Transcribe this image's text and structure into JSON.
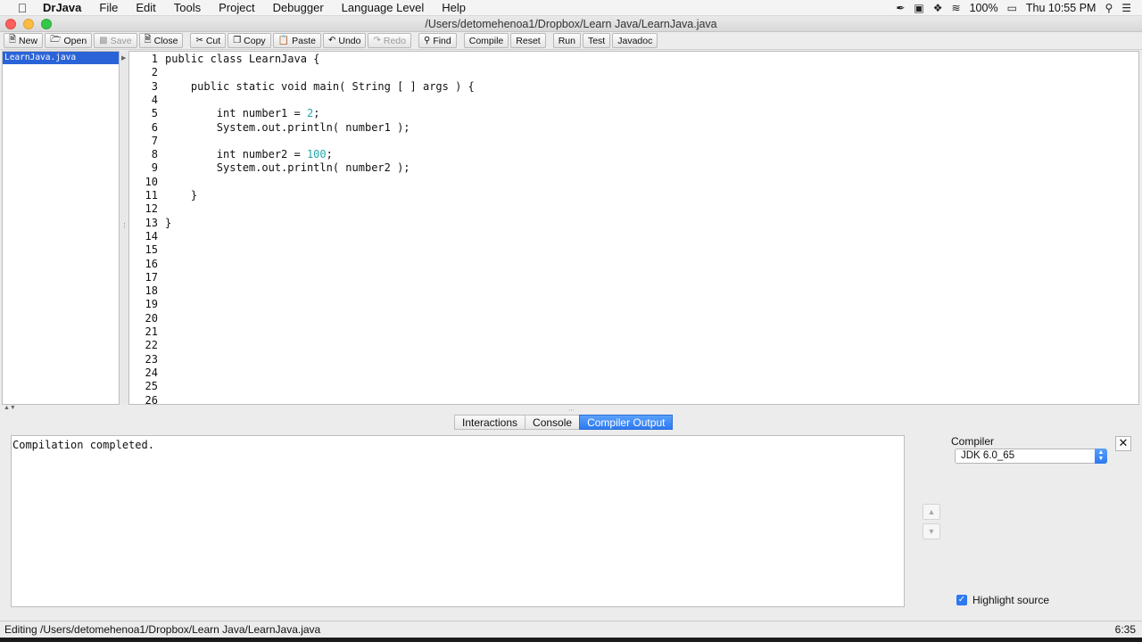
{
  "menubar": {
    "app_name": "DrJava",
    "items": [
      "File",
      "Edit",
      "Tools",
      "Project",
      "Debugger",
      "Language Level",
      "Help"
    ],
    "battery": "100%",
    "clock": "Thu 10:55 PM"
  },
  "window": {
    "title": "/Users/detomehenoa1/Dropbox/Learn Java/LearnJava.java"
  },
  "toolbar": {
    "new": "New",
    "open": "Open",
    "save": "Save",
    "close": "Close",
    "cut": "Cut",
    "copy": "Copy",
    "paste": "Paste",
    "undo": "Undo",
    "redo": "Redo",
    "find": "Find",
    "compile": "Compile",
    "reset": "Reset",
    "run": "Run",
    "test": "Test",
    "javadoc": "Javadoc"
  },
  "files": [
    "LearnJava.java"
  ],
  "editor": {
    "lines": [
      {
        "n": "1",
        "pre": "public class LearnJava {",
        "num": "",
        "post": ""
      },
      {
        "n": "2",
        "pre": "",
        "num": "",
        "post": ""
      },
      {
        "n": "3",
        "pre": "    public static void main( String [ ] args ) {",
        "num": "",
        "post": ""
      },
      {
        "n": "4",
        "pre": "",
        "num": "",
        "post": ""
      },
      {
        "n": "5",
        "pre": "        int number1 = ",
        "num": "2",
        "post": ";"
      },
      {
        "n": "6",
        "pre": "        System.out.println( number1 );",
        "num": "",
        "post": ""
      },
      {
        "n": "7",
        "pre": "",
        "num": "",
        "post": ""
      },
      {
        "n": "8",
        "pre": "        int number2 = ",
        "num": "100",
        "post": ";"
      },
      {
        "n": "9",
        "pre": "        System.out.println( number2 );",
        "num": "",
        "post": ""
      },
      {
        "n": "10",
        "pre": "",
        "num": "",
        "post": ""
      },
      {
        "n": "11",
        "pre": "    }",
        "num": "",
        "post": ""
      },
      {
        "n": "12",
        "pre": "",
        "num": "",
        "post": ""
      },
      {
        "n": "13",
        "pre": "}",
        "num": "",
        "post": ""
      },
      {
        "n": "14",
        "pre": "",
        "num": "",
        "post": ""
      },
      {
        "n": "15",
        "pre": "",
        "num": "",
        "post": ""
      },
      {
        "n": "16",
        "pre": "",
        "num": "",
        "post": ""
      },
      {
        "n": "17",
        "pre": "",
        "num": "",
        "post": ""
      },
      {
        "n": "18",
        "pre": "",
        "num": "",
        "post": ""
      },
      {
        "n": "19",
        "pre": "",
        "num": "",
        "post": ""
      },
      {
        "n": "20",
        "pre": "",
        "num": "",
        "post": ""
      },
      {
        "n": "21",
        "pre": "",
        "num": "",
        "post": ""
      },
      {
        "n": "22",
        "pre": "",
        "num": "",
        "post": ""
      },
      {
        "n": "23",
        "pre": "",
        "num": "",
        "post": ""
      },
      {
        "n": "24",
        "pre": "",
        "num": "",
        "post": ""
      },
      {
        "n": "25",
        "pre": "",
        "num": "",
        "post": ""
      },
      {
        "n": "26",
        "pre": "",
        "num": "",
        "post": ""
      }
    ]
  },
  "tabs": [
    {
      "label": "Interactions",
      "active": false
    },
    {
      "label": "Console",
      "active": false
    },
    {
      "label": "Compiler Output",
      "active": true
    }
  ],
  "output": {
    "text": "Compilation completed."
  },
  "compiler_panel": {
    "label": "Compiler",
    "selected": "JDK 6.0_65",
    "highlight_source_label": "Highlight source",
    "highlight_source_checked": true
  },
  "statusbar": {
    "text": "Editing /Users/detomehenoa1/Dropbox/Learn Java/LearnJava.java",
    "position": "6:35"
  },
  "colors": {
    "selection_blue": "#2a63d8",
    "tab_active": "#2c79f0",
    "number_literal": "#22a6a6"
  }
}
